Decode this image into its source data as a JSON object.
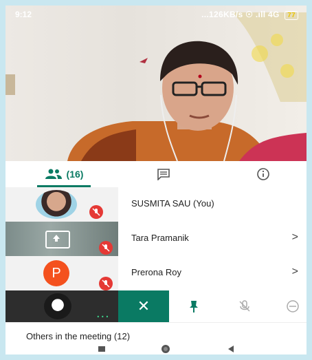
{
  "status": {
    "time": "9:12",
    "right": "...126KB/s ☉ .ıll 4G ",
    "battery": "77"
  },
  "tabs": {
    "people_count": "(16)"
  },
  "participants": [
    {
      "name": "SUSMITA SAU (You)",
      "avatar_letter": "",
      "has_chevron": false
    },
    {
      "name": "Tara Pramanik",
      "avatar_letter": "",
      "has_chevron": true
    },
    {
      "name": "Prerona Roy",
      "avatar_letter": "P",
      "has_chevron": true
    }
  ],
  "chevron": ">",
  "controls": {
    "close": "✕",
    "dots": "..."
  },
  "others": {
    "label": "Others in the meeting (12)"
  },
  "colors": {
    "accent": "#0a7a63",
    "mute": "#e53935",
    "avatar_p": "#f4511e"
  },
  "icons": [
    "people-icon",
    "chat-icon",
    "info-icon",
    "mic-off-icon",
    "present-icon",
    "pin-icon",
    "remove-icon"
  ]
}
